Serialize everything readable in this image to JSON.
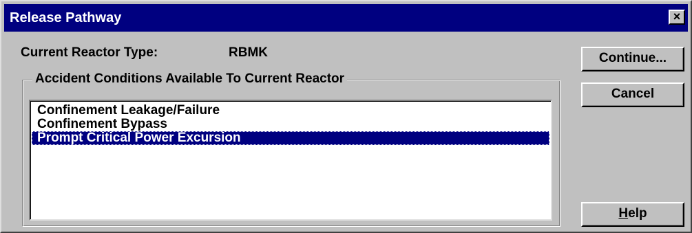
{
  "window": {
    "title": "Release Pathway",
    "close_glyph": "×",
    "close_icon": "close-icon"
  },
  "reactor": {
    "label": "Current Reactor Type:",
    "value": "RBMK"
  },
  "group": {
    "legend": "Accident Conditions Available To Current Reactor"
  },
  "list": {
    "items": [
      "Confinement Leakage/Failure",
      "Confinement Bypass",
      "Prompt Critical Power Excursion"
    ],
    "selected": "Prompt Critical Power Excursion"
  },
  "buttons": {
    "continue": "Continue...",
    "cancel": "Cancel",
    "help_accel": "H",
    "help_rest": "elp"
  },
  "colors": {
    "titlebar": "#000080",
    "face": "#c0c0c0",
    "selection": "#000080"
  }
}
